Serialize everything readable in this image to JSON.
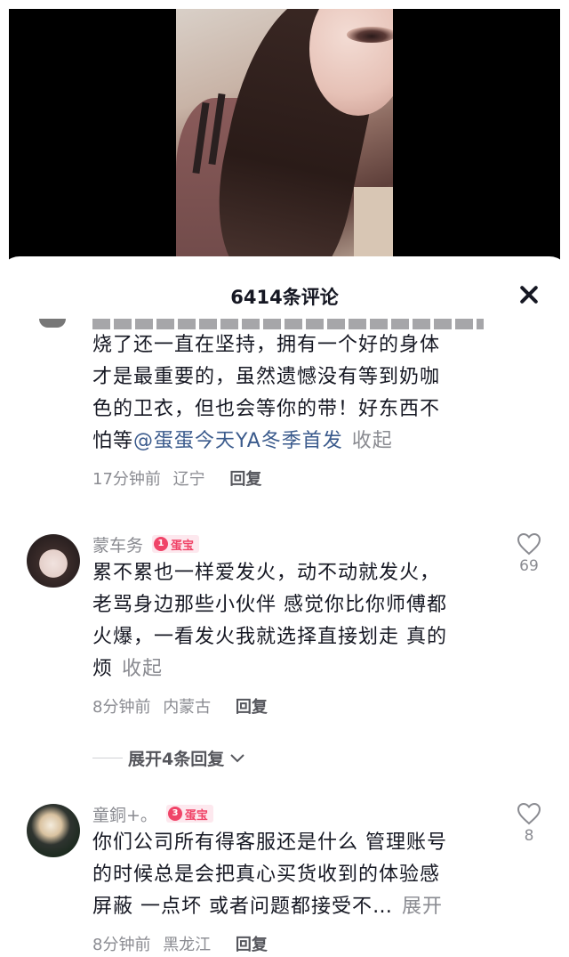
{
  "sheet": {
    "title": "6414条评论"
  },
  "comments": [
    {
      "lines": [
        "烧了还一直在坚持，拥有一个好的身体",
        "才是最重要的，虽然遗憾没有等到奶咖",
        "色的卫衣，但也会等你的带！好东西不"
      ],
      "last_line_prefix": "怕等",
      "mention": "@蛋蛋今天YA冬季首发",
      "toggle": "收起",
      "time": "17分钟前",
      "location": "辽宁",
      "reply": "回复"
    },
    {
      "username": "蒙车务",
      "badge_level": "1",
      "badge_text": "蛋宝",
      "lines": [
        "累不累也一样爱发火，动不动就发火，",
        "老骂身边那些小伙伴 感觉你比你师傅都",
        "火爆，一看发火我就选择直接划走 真的"
      ],
      "last_line": "烦",
      "toggle": "收起",
      "time": "8分钟前",
      "location": "内蒙古",
      "reply": "回复",
      "likes": "69",
      "expand": "展开4条回复"
    },
    {
      "username": "童銅+。",
      "badge_level": "3",
      "badge_text": "蛋宝",
      "lines": [
        "你们公司所有得客服还是什么 管理账号",
        "的时候总是会把真心买货收到的体验感"
      ],
      "last_line": "屏蔽 一点坏 或者问题都接受不…",
      "toggle": "展开",
      "time": "8分钟前",
      "location": "黑龙江",
      "reply": "回复",
      "likes": "8"
    }
  ],
  "icons": {
    "close": "close-icon",
    "heart": "heart-outline-icon",
    "chevron": "chevron-down-icon"
  },
  "colors": {
    "badge": "#f04468",
    "mention": "#3a5a8c",
    "muted": "#8a8b91"
  }
}
